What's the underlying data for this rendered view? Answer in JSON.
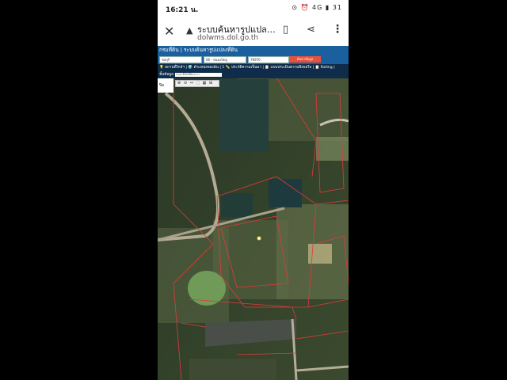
{
  "status_bar": {
    "time": "16:21 น.",
    "icons": "⊙ ⏰ 4G ▮ 31"
  },
  "browser": {
    "page_title": "ระบบค้นหารูปแปล…",
    "domain": "dolwms.dol.go.th"
  },
  "site": {
    "header": "กรมที่ดิน | ระบบค้นหารูปแปลงที่ดิน",
    "search": {
      "province": "ชลบุรี",
      "district": "06 - หนองใหญ่",
      "parcel_no": "76970",
      "button": "ค้นหาข้อมูล"
    },
    "toolbar": "💡 สถานที่ใกล้ฯ | 🌍 ตำแหน่งของฉัน | 1 📏 ประวัติความเป็นมา | 📋 แบบประเมินความพึงพอใจ | 📋 Rating |",
    "layer_button": "ชั้นข้อมูล",
    "coord_placeholder": "กรอกพิกัดที่ต้องการ",
    "left_panel": "ปิด"
  },
  "map_tools": [
    "⊕",
    "⊖",
    "↔",
    "⬚",
    "▦",
    "⊞"
  ],
  "colors": {
    "header": "#1a5f9e",
    "toolbar": "#0f2d4a",
    "search_button": "#e8523a",
    "parcel_line": "#e03a3a"
  }
}
